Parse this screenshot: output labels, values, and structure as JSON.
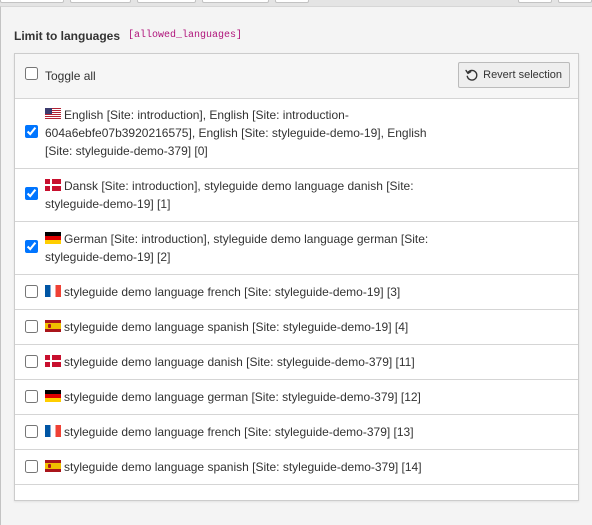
{
  "field": {
    "label": "Limit to languages",
    "code": "[allowed_languages]"
  },
  "toolbar": {
    "toggle_all_label": "Toggle all",
    "revert_label": "Revert selection"
  },
  "languages": [
    {
      "flag": "us",
      "checked": true,
      "label": "English [Site: introduction], English [Site: introduction-604a6ebfe07b3920216575], English [Site: styleguide-demo-19], English [Site: styleguide-demo-379] [0]"
    },
    {
      "flag": "dk",
      "checked": true,
      "label": "Dansk [Site: introduction], styleguide demo language danish [Site: styleguide-demo-19] [1]"
    },
    {
      "flag": "de",
      "checked": true,
      "label": "German [Site: introduction], styleguide demo language german [Site: styleguide-demo-19] [2]"
    },
    {
      "flag": "fr",
      "checked": false,
      "label": "styleguide demo language french [Site: styleguide-demo-19] [3]"
    },
    {
      "flag": "es",
      "checked": false,
      "label": "styleguide demo language spanish [Site: styleguide-demo-19] [4]"
    },
    {
      "flag": "dk",
      "checked": false,
      "label": "styleguide demo language danish [Site: styleguide-demo-379] [11]"
    },
    {
      "flag": "de",
      "checked": false,
      "label": "styleguide demo language german [Site: styleguide-demo-379] [12]"
    },
    {
      "flag": "fr",
      "checked": false,
      "label": "styleguide demo language french [Site: styleguide-demo-379] [13]"
    },
    {
      "flag": "es",
      "checked": false,
      "label": "styleguide demo language spanish [Site: styleguide-demo-379] [14]"
    }
  ],
  "icons": {
    "revert": "revert-icon",
    "us": "flag-us-icon",
    "dk": "flag-dk-icon",
    "de": "flag-de-icon",
    "fr": "flag-fr-icon",
    "es": "flag-es-icon"
  },
  "colors": {
    "field_code": "#b0157b",
    "border": "#d5d5d5",
    "header_bg": "#f6f6f6"
  }
}
